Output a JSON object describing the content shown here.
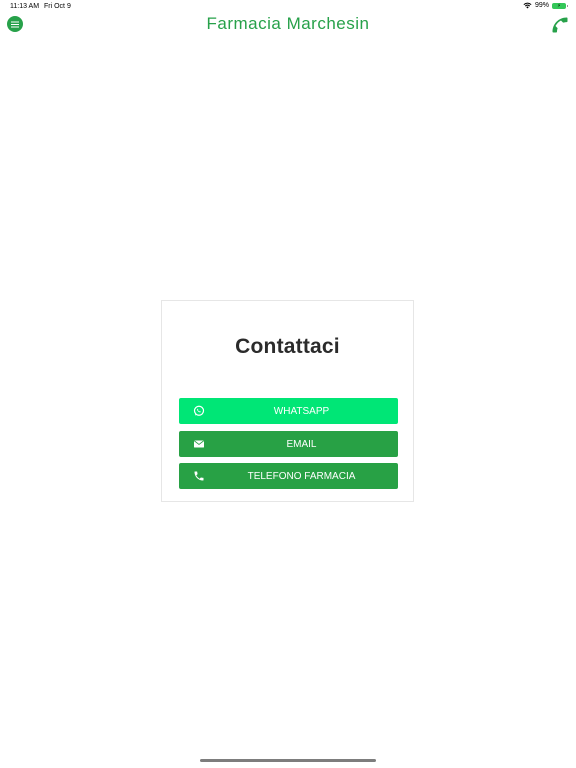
{
  "status_bar": {
    "time": "11:13 AM",
    "date": "Fri Oct 9",
    "battery_percent": "99%",
    "wifi_icon": "wifi-icon",
    "battery_icon": "battery-charging-icon"
  },
  "nav": {
    "title": "Farmacia Marchesin",
    "menu_icon": "menu-icon",
    "phone_icon": "phone-icon"
  },
  "card": {
    "title": "Contattaci",
    "buttons": [
      {
        "label": "WHATSAPP",
        "icon": "whatsapp-icon",
        "color": "#00e676"
      },
      {
        "label": "EMAIL",
        "icon": "email-icon",
        "color": "#28a145"
      },
      {
        "label": "TELEFONO FARMACIA",
        "icon": "phone-icon",
        "color": "#28a145"
      }
    ]
  },
  "colors": {
    "brand_green": "#27a14a",
    "whatsapp_green": "#00e676",
    "title_text": "#2b2b2b"
  }
}
